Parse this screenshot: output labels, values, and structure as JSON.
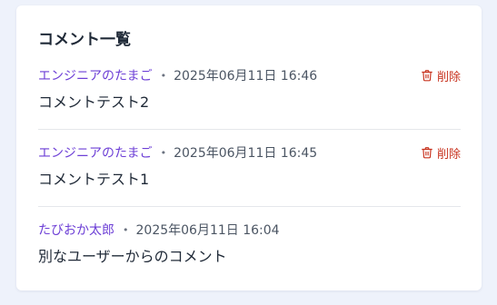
{
  "section_title": "コメント一覧",
  "comments": [
    {
      "author": "エンジニアのたまご",
      "timestamp": "2025年06月11日 16:46",
      "body": "コメントテスト2",
      "delete_label": "削除",
      "delete_icon": "trash-icon"
    },
    {
      "author": "エンジニアのたまご",
      "timestamp": "2025年06月11日 16:45",
      "body": "コメントテスト1",
      "delete_label": "削除",
      "delete_icon": "trash-icon"
    },
    {
      "author": "たびおか太郎",
      "timestamp": "2025年06月11日 16:04",
      "body": "別なユーザーからのコメント"
    }
  ],
  "separator": "•",
  "colors": {
    "author": "#6d3fd6",
    "delete": "#c8331f",
    "background": "#eef2fb"
  }
}
